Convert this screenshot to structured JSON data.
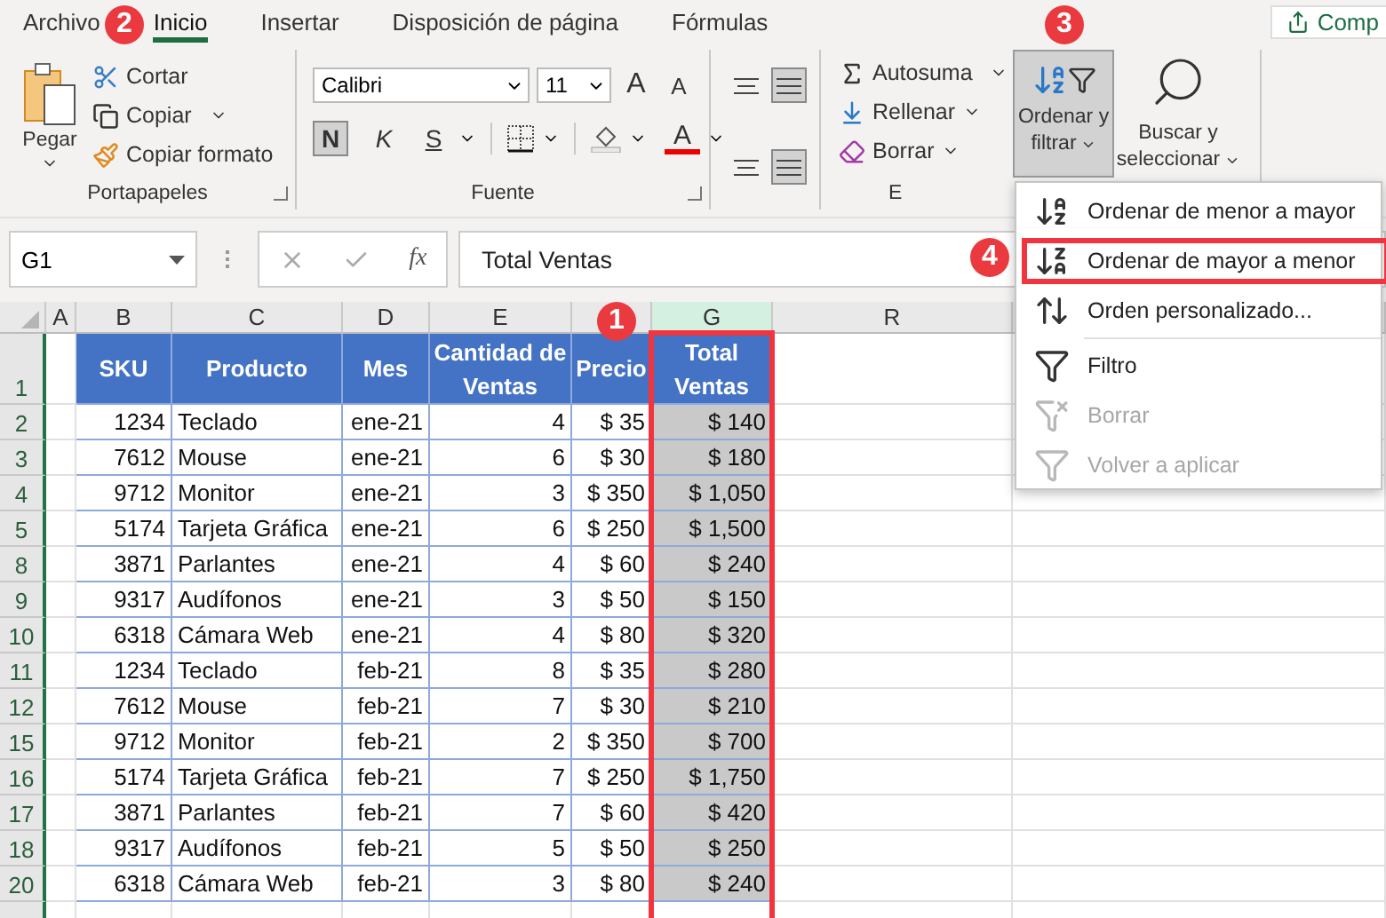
{
  "tabs": [
    {
      "label": "Archivo",
      "selected": false
    },
    {
      "label": "Inicio",
      "selected": true
    },
    {
      "label": "Insertar",
      "selected": false
    },
    {
      "label": "Disposición de página",
      "selected": false
    },
    {
      "label": "Fórmulas",
      "selected": false
    }
  ],
  "share_button": {
    "label": "Comp"
  },
  "ribbon": {
    "clipboard": {
      "paste": "Pegar",
      "cut": "Cortar",
      "copy": "Copiar",
      "format_painter": "Copiar formato",
      "group_label": "Portapapeles"
    },
    "font": {
      "font_name": "Calibri",
      "font_size": "11",
      "grow": "A",
      "shrink": "A",
      "bold": {
        "label": "N",
        "on": true
      },
      "italic": "K",
      "underline": "S",
      "font_color": "A",
      "group_label": "Fuente"
    },
    "alignment": [
      {
        "on": false
      },
      {
        "on": true
      },
      {
        "on": false
      },
      {
        "on": true
      }
    ],
    "editing": {
      "autosum": "Autosuma",
      "fill": "Rellenar",
      "clear": "Borrar",
      "sort_filter": {
        "lines": [
          "Ordenar y",
          "filtrar"
        ],
        "on": true
      },
      "find_select": {
        "lines": [
          "Buscar y",
          "seleccionar"
        ]
      },
      "group_label": "E"
    }
  },
  "formula_bar": {
    "name_box": "G1",
    "function_label": "fx",
    "formula": "Total Ventas"
  },
  "columns": [
    {
      "letter": "A",
      "selected": false
    },
    {
      "letter": "B",
      "selected": false
    },
    {
      "letter": "C",
      "selected": false
    },
    {
      "letter": "D",
      "selected": false
    },
    {
      "letter": "E",
      "selected": false
    },
    {
      "selected": false
    },
    {
      "letter": "G",
      "selected": true
    },
    {
      "letter": "R",
      "selected": false
    }
  ],
  "header_row": {
    "row": "1",
    "cells": [
      "SKU",
      "Producto",
      "Mes",
      "Cantidad de Ventas",
      "Precio",
      "Total Ventas"
    ]
  },
  "rows": [
    {
      "row": "2",
      "cells": [
        "1234",
        "Teclado",
        "ene-21",
        "4",
        "$ 35",
        "$ 140"
      ]
    },
    {
      "row": "3",
      "cells": [
        "7612",
        "Mouse",
        "ene-21",
        "6",
        "$ 30",
        "$ 180"
      ]
    },
    {
      "row": "4",
      "cells": [
        "9712",
        "Monitor",
        "ene-21",
        "3",
        "$ 350",
        "$ 1,050"
      ]
    },
    {
      "row": "5",
      "cells": [
        "5174",
        "Tarjeta Gráfica",
        "ene-21",
        "6",
        "$ 250",
        "$ 1,500"
      ]
    },
    {
      "row": "8",
      "cells": [
        "3871",
        "Parlantes",
        "ene-21",
        "4",
        "$ 60",
        "$ 240"
      ]
    },
    {
      "row": "9",
      "cells": [
        "9317",
        "Audífonos",
        "ene-21",
        "3",
        "$ 50",
        "$ 150"
      ]
    },
    {
      "row": "10",
      "cells": [
        "6318",
        "Cámara Web",
        "ene-21",
        "4",
        "$ 80",
        "$ 320"
      ]
    },
    {
      "row": "11",
      "cells": [
        "1234",
        "Teclado",
        "feb-21",
        "8",
        "$ 35",
        "$ 280"
      ]
    },
    {
      "row": "12",
      "cells": [
        "7612",
        "Mouse",
        "feb-21",
        "7",
        "$ 30",
        "$ 210"
      ]
    },
    {
      "row": "15",
      "cells": [
        "9712",
        "Monitor",
        "feb-21",
        "2",
        "$ 350",
        "$ 700"
      ]
    },
    {
      "row": "16",
      "cells": [
        "5174",
        "Tarjeta Gráfica",
        "feb-21",
        "7",
        "$ 250",
        "$ 1,750"
      ]
    },
    {
      "row": "17",
      "cells": [
        "3871",
        "Parlantes",
        "feb-21",
        "7",
        "$ 60",
        "$ 420"
      ]
    },
    {
      "row": "18",
      "cells": [
        "9317",
        "Audífonos",
        "feb-21",
        "5",
        "$ 50",
        "$ 250"
      ]
    },
    {
      "row": "20",
      "cells": [
        "6318",
        "Cámara Web",
        "feb-21",
        "3",
        "$ 80",
        "$ 240"
      ]
    }
  ],
  "sort_menu": [
    {
      "kind": "sort_asc",
      "label": "Ordenar de menor a mayor",
      "disabled": false,
      "highlighted": false
    },
    {
      "kind": "sort_desc",
      "label": "Ordenar de mayor a menor",
      "disabled": false,
      "highlighted": true
    },
    {
      "kind": "custom",
      "label": "Orden personalizado...",
      "disabled": false,
      "highlighted": false
    },
    {
      "kind": "filter",
      "label": "Filtro",
      "disabled": false,
      "highlighted": false
    },
    {
      "kind": "clear",
      "label": "Borrar",
      "disabled": true,
      "highlighted": false
    },
    {
      "kind": "reapply",
      "label": "Volver a aplicar",
      "disabled": true,
      "highlighted": false
    }
  ],
  "badges": [
    {
      "number": "1"
    },
    {
      "number": "2"
    },
    {
      "number": "3"
    },
    {
      "number": "4"
    }
  ]
}
